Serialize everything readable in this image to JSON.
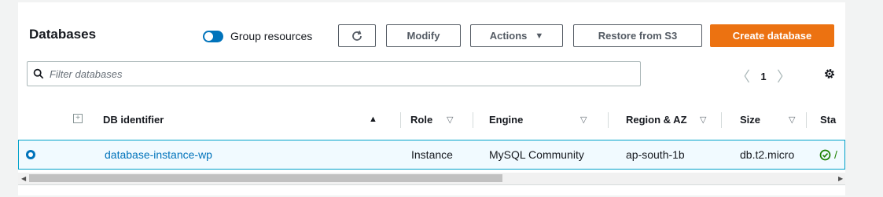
{
  "header": {
    "title": "Databases",
    "group_resources_label": "Group resources",
    "group_resources_on": true
  },
  "toolbar": {
    "refresh_icon": "refresh-icon",
    "modify_label": "Modify",
    "actions_label": "Actions",
    "restore_label": "Restore from S3",
    "create_label": "Create database"
  },
  "search": {
    "placeholder": "Filter databases"
  },
  "pagination": {
    "current_page": "1"
  },
  "table": {
    "columns": {
      "db_identifier": "DB identifier",
      "role": "Role",
      "engine": "Engine",
      "region": "Region & AZ",
      "size": "Size",
      "status": "Sta"
    },
    "rows": [
      {
        "identifier": "database-instance-wp",
        "role": "Instance",
        "engine": "MySQL Community",
        "region": "ap-south-1b",
        "size": "db.t2.micro",
        "status": "/"
      }
    ]
  },
  "colors": {
    "accent": "#0073bb",
    "primary_button": "#ec7211",
    "success": "#1d8102",
    "selected_row_bg": "#f1faff"
  }
}
